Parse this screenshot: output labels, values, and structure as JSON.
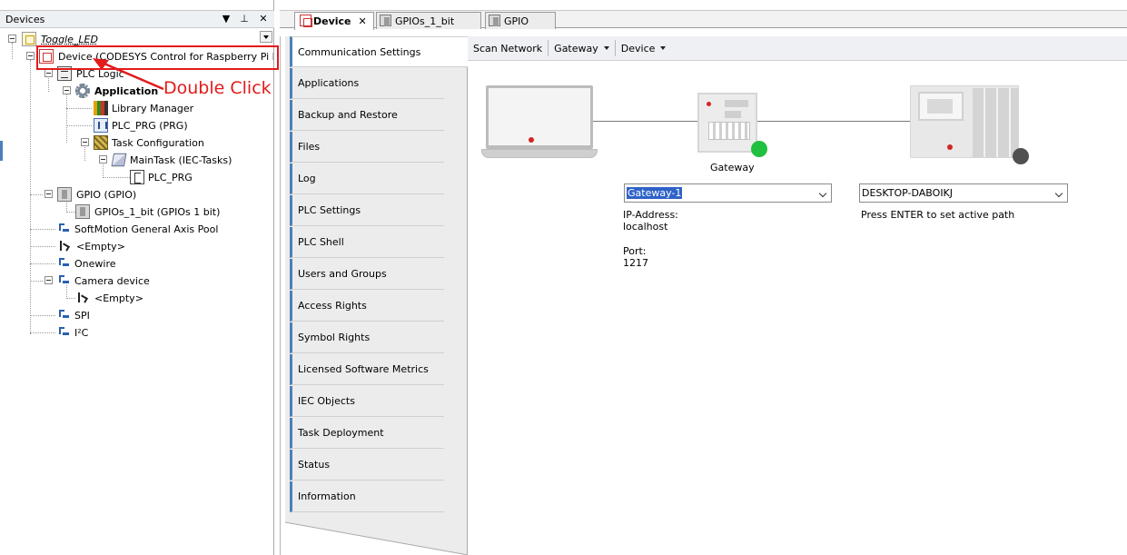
{
  "devices_panel": {
    "title": "Devices",
    "buttons": {
      "dropdown": "▼",
      "pin": "⊥",
      "close": "✕"
    }
  },
  "tree": {
    "project": "Toggle_LED",
    "device": "Device (CODESYS Control for Raspberry Pi MC SL)",
    "plc_logic": "PLC Logic",
    "application": "Application",
    "library_manager": "Library Manager",
    "plc_prg": "PLC_PRG (PRG)",
    "task_configuration": "Task Configuration",
    "main_task": "MainTask (IEC-Tasks)",
    "plc_prg_call": "PLC_PRG",
    "gpio": "GPIO (GPIO)",
    "gpios_1_bit": "GPIOs_1_bit (GPIOs 1 bit)",
    "softmotion_pool": "SoftMotion General Axis Pool",
    "empty_1": "<Empty>",
    "onewire": "Onewire",
    "camera_device": "Camera device",
    "empty_2": "<Empty>",
    "spi": "SPI",
    "i2c": "I²C"
  },
  "annotation": {
    "text": "Double Click",
    "color": "#e21b1b"
  },
  "editor_tabs": [
    {
      "label": "Device",
      "close": "✕"
    },
    {
      "label": "GPIOs_1_bit"
    },
    {
      "label": "GPIO"
    }
  ],
  "side_tabs": [
    "Communication Settings",
    "Applications",
    "Backup and Restore",
    "Files",
    "Log",
    "PLC Settings",
    "PLC Shell",
    "Users and Groups",
    "Access Rights",
    "Symbol Rights",
    "Licensed Software Metrics",
    "IEC Objects",
    "Task Deployment",
    "Status",
    "Information"
  ],
  "toolbar": {
    "scan_network": "Scan Network",
    "gateway": "Gateway",
    "device": "Device"
  },
  "network": {
    "gateway_label": "Gateway",
    "gateway_combo": "Gateway-1",
    "ip_address_label": "IP-Address:",
    "ip_address_value": "localhost",
    "port_label": "Port:",
    "port_value": "1217",
    "device_combo": "DESKTOP-DABOIKJ",
    "device_hint": "Press ENTER to set active path",
    "gateway_status_color": "#20c040",
    "device_status_color": "#505050"
  }
}
